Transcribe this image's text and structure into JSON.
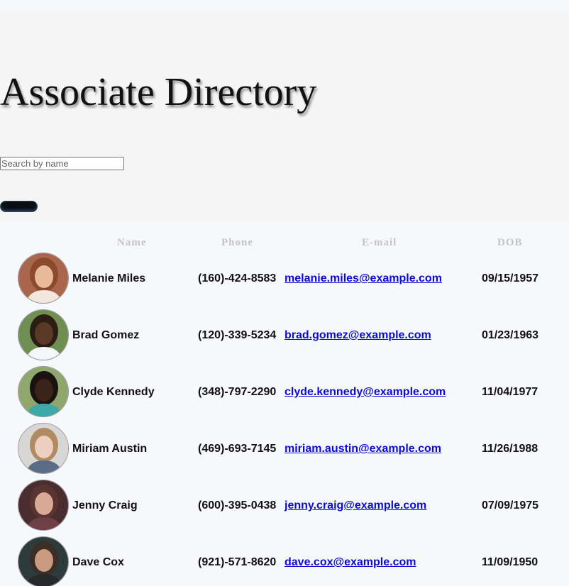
{
  "header": {
    "title": "Associate Directory",
    "search_placeholder": "Search by name",
    "search_value": "",
    "search_button_label": "Search"
  },
  "table": {
    "columns": [
      "Name",
      "Phone",
      "E-mail",
      "DOB"
    ],
    "rows": [
      {
        "name": "Melanie Miles",
        "phone": "(160)-424-8583",
        "email": "melanie.miles@example.com",
        "dob": "09/15/1957",
        "avatar_colors": {
          "bg": "#a9664c",
          "skin": "#e9b99c",
          "hair": "#8b4a2c",
          "shirt": "#f2e7df"
        }
      },
      {
        "name": "Brad Gomez",
        "phone": "(120)-339-5234",
        "email": "brad.gomez@example.com",
        "dob": "01/23/1963",
        "avatar_colors": {
          "bg": "#6f8e52",
          "skin": "#5a3927",
          "hair": "#2c1d14",
          "shirt": "#f4f6f8"
        }
      },
      {
        "name": "Clyde Kennedy",
        "phone": "(348)-797-2290",
        "email": "clyde.kennedy@example.com",
        "dob": "11/04/1977",
        "avatar_colors": {
          "bg": "#8fa66d",
          "skin": "#3a2419",
          "hair": "#1a1210",
          "shirt": "#3fa8a8"
        }
      },
      {
        "name": "Miriam Austin",
        "phone": "(469)-693-7145",
        "email": "miriam.austin@example.com",
        "dob": "11/26/1988",
        "avatar_colors": {
          "bg": "#d9d7d6",
          "skin": "#edcfc0",
          "hair": "#b08a63",
          "shirt": "#5b6c86"
        }
      },
      {
        "name": "Jenny Craig",
        "phone": "(600)-395-0438",
        "email": "jenny.craig@example.com",
        "dob": "07/09/1975",
        "avatar_colors": {
          "bg": "#4a2d31",
          "skin": "#d9a997",
          "hair": "#5a3430",
          "shirt": "#6e3f44"
        }
      },
      {
        "name": "Dave Cox",
        "phone": "(921)-571-8620",
        "email": "dave.cox@example.com",
        "dob": "11/09/1950",
        "avatar_colors": {
          "bg": "#2e3b3c",
          "skin": "#c99a80",
          "hair": "#3b2e25",
          "shirt": "#27292b"
        }
      }
    ]
  }
}
